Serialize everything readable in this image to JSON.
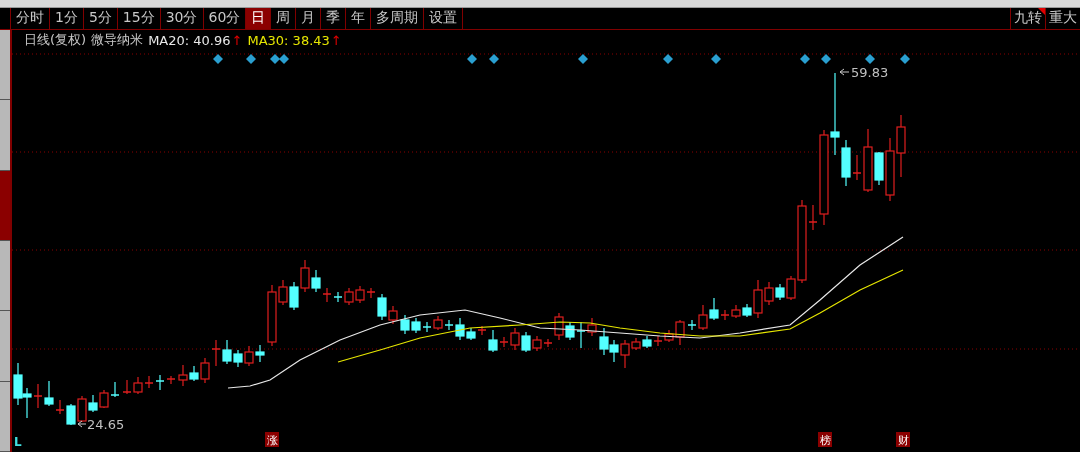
{
  "period_tabs": [
    {
      "label": "分时",
      "selected": false
    },
    {
      "label": "1分",
      "selected": false
    },
    {
      "label": "5分",
      "selected": false
    },
    {
      "label": "15分",
      "selected": false
    },
    {
      "label": "30分",
      "selected": false
    },
    {
      "label": "60分",
      "selected": false
    },
    {
      "label": "日",
      "selected": true
    },
    {
      "label": "周",
      "selected": false
    },
    {
      "label": "月",
      "selected": false
    },
    {
      "label": "季",
      "selected": false
    },
    {
      "label": "年",
      "selected": false
    },
    {
      "label": "多周期",
      "selected": false
    },
    {
      "label": "设置",
      "selected": false
    }
  ],
  "right_tabs": [
    {
      "label": "九转",
      "flagged": true
    },
    {
      "label": "重大",
      "flagged": false
    }
  ],
  "side_tabs": [
    {
      "selected": false
    },
    {
      "selected": false
    },
    {
      "selected": true
    },
    {
      "selected": false
    },
    {
      "selected": false
    },
    {
      "selected": false
    }
  ],
  "chart": {
    "adjust_label": "日线(复权)",
    "stock_name": "微导纳米",
    "indicators": [
      {
        "label": "MA20: 40.96",
        "trend": "↑",
        "color": "#e8e8e8"
      },
      {
        "label": "MA30: 38.43",
        "trend": "↑",
        "color": "#e6e600"
      }
    ],
    "low_label": "24.65",
    "high_label": "59.83",
    "markers": [
      {
        "label": "L",
        "kind": "letter"
      },
      {
        "label": "涨",
        "kind": "badge"
      },
      {
        "label": "榜",
        "kind": "badge"
      },
      {
        "label": "财",
        "kind": "badge"
      }
    ]
  }
}
